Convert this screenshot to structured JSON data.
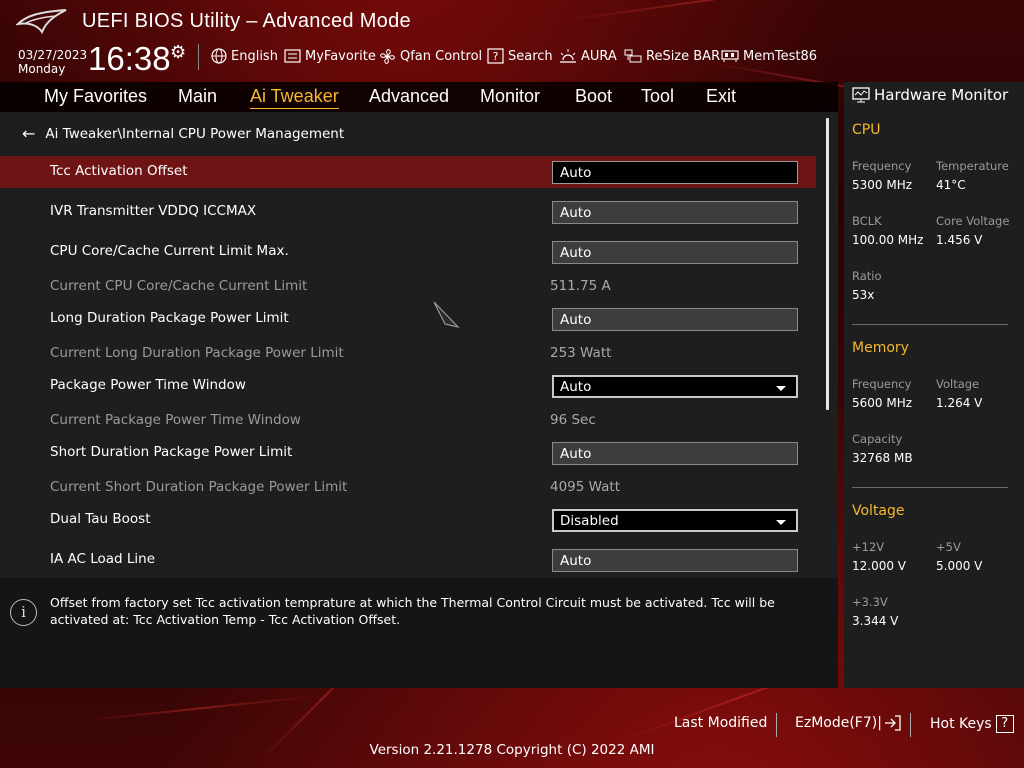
{
  "app": {
    "title": "UEFI BIOS Utility – Advanced Mode"
  },
  "header": {
    "date": "03/27/2023",
    "day": "Monday",
    "time": "16:38",
    "toolbar": [
      {
        "icon": "globe-icon",
        "label": "English"
      },
      {
        "icon": "favorite-icon",
        "label": "MyFavorite"
      },
      {
        "icon": "fan-icon",
        "label": "Qfan Control"
      },
      {
        "icon": "search-icon",
        "label": "Search"
      },
      {
        "icon": "aura-icon",
        "label": "AURA"
      },
      {
        "icon": "resize-bar-icon",
        "label": "ReSize BAR"
      },
      {
        "icon": "memtest-icon",
        "label": "MemTest86"
      }
    ]
  },
  "menu": {
    "tabs": [
      "My Favorites",
      "Main",
      "Ai Tweaker",
      "Advanced",
      "Monitor",
      "Boot",
      "Tool",
      "Exit"
    ],
    "active": "Ai Tweaker"
  },
  "breadcrumb": "Ai Tweaker\\Internal CPU Power Management",
  "settings": [
    {
      "label": "Tcc Activation Offset",
      "value": "Auto",
      "kind": "input",
      "selected": true
    },
    {
      "label": "IVR Transmitter VDDQ ICCMAX",
      "value": "Auto",
      "kind": "input"
    },
    {
      "label": "CPU Core/Cache Current Limit Max.",
      "value": "Auto",
      "kind": "input"
    },
    {
      "label": "Current CPU Core/Cache Current Limit",
      "value": "511.75 A",
      "kind": "readonly"
    },
    {
      "label": "Long Duration Package Power Limit",
      "value": "Auto",
      "kind": "input"
    },
    {
      "label": "Current Long Duration Package Power Limit",
      "value": "253 Watt",
      "kind": "readonly"
    },
    {
      "label": "Package Power Time Window",
      "value": "Auto",
      "kind": "dropdown"
    },
    {
      "label": "Current Package Power Time Window",
      "value": "96 Sec",
      "kind": "readonly"
    },
    {
      "label": "Short Duration Package Power Limit",
      "value": "Auto",
      "kind": "input"
    },
    {
      "label": "Current Short Duration Package Power Limit",
      "value": "4095 Watt",
      "kind": "readonly"
    },
    {
      "label": "Dual Tau Boost",
      "value": "Disabled",
      "kind": "dropdown"
    },
    {
      "label": "IA AC Load Line",
      "value": "Auto",
      "kind": "input"
    }
  ],
  "help": {
    "text": "Offset from factory set Tcc activation temprature at which the Thermal Control Circuit must be activated. Tcc will be activated at: Tcc Activation Temp - Tcc Activation Offset."
  },
  "hardware_monitor": {
    "title": "Hardware Monitor",
    "cpu": {
      "heading": "CPU",
      "frequency_label": "Frequency",
      "frequency": "5300 MHz",
      "temperature_label": "Temperature",
      "temperature": "41°C",
      "bclk_label": "BCLK",
      "bclk": "100.00 MHz",
      "core_voltage_label": "Core Voltage",
      "core_voltage": "1.456 V",
      "ratio_label": "Ratio",
      "ratio": "53x"
    },
    "memory": {
      "heading": "Memory",
      "frequency_label": "Frequency",
      "frequency": "5600 MHz",
      "voltage_label": "Voltage",
      "voltage": "1.264 V",
      "capacity_label": "Capacity",
      "capacity": "32768 MB"
    },
    "voltage": {
      "heading": "Voltage",
      "v12_label": "+12V",
      "v12": "12.000 V",
      "v5_label": "+5V",
      "v5": "5.000 V",
      "v33_label": "+3.3V",
      "v33": "3.344 V"
    }
  },
  "footer": {
    "last_modified": "Last Modified",
    "ezmode": "EzMode(F7)|",
    "hotkeys": "Hot Keys",
    "hotkeys_key": "?",
    "version": "Version 2.21.1278 Copyright (C) 2022 AMI"
  },
  "colors": {
    "accent": "#f5b82e",
    "selected_row": "#6e1414",
    "panel": "#1e1e1e"
  }
}
